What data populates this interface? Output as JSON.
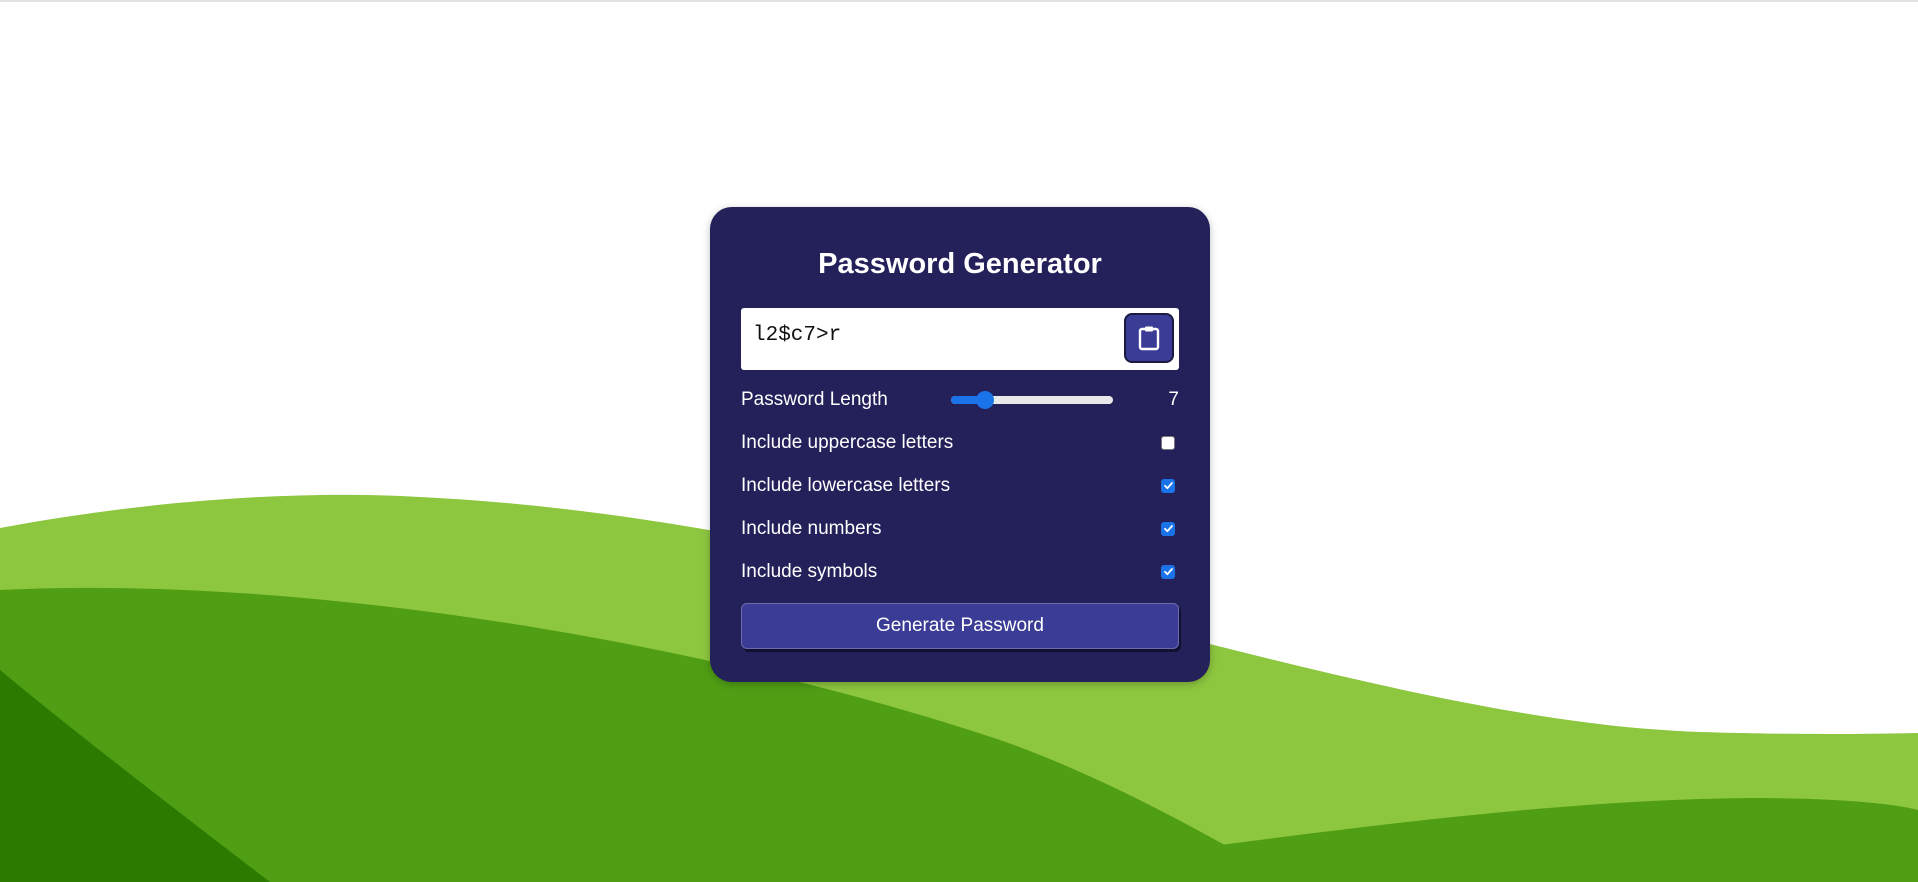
{
  "app": {
    "title": "Password Generator"
  },
  "output": {
    "password": "l2$c7>r",
    "copy_icon": "clipboard-icon"
  },
  "length": {
    "label": "Password Length",
    "value": "7",
    "slider_fraction": 0.21
  },
  "options": [
    {
      "label": "Include uppercase letters",
      "checked": false
    },
    {
      "label": "Include lowercase letters",
      "checked": true
    },
    {
      "label": "Include numbers",
      "checked": true
    },
    {
      "label": "Include symbols",
      "checked": true
    }
  ],
  "generate": {
    "label": "Generate Password"
  },
  "colors": {
    "card": "#23205a",
    "button": "#3b3c96",
    "accent": "#1a73e8",
    "wave_light": "#8dc63f",
    "wave_mid": "#4f9e14",
    "wave_dark": "#2d7a00"
  }
}
